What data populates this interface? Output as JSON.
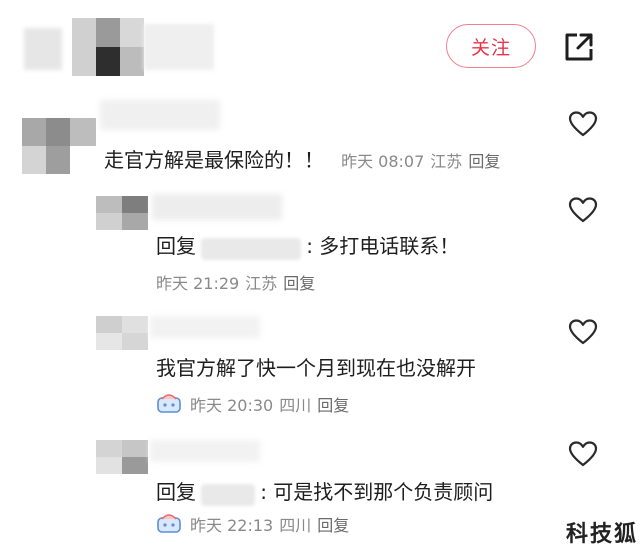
{
  "header": {
    "follow_label": "关注",
    "share_icon": "share-icon"
  },
  "comments": [
    {
      "text": "走官方解是最保险的！！",
      "time": "昨天 08:07",
      "location": "江苏",
      "reply_label": "回复"
    }
  ],
  "replies": [
    {
      "prefix": "回复",
      "text": ": 多打电话联系！",
      "time": "昨天 21:29",
      "location": "江苏",
      "reply_label": "回复"
    },
    {
      "text": "我官方解了快一个月到现在也没解开",
      "time": "昨天 20:30",
      "location": "四川",
      "reply_label": "回复"
    },
    {
      "prefix": "回复",
      "text": ": 可是找不到那个负责顾问",
      "time": "昨天 22:13",
      "location": "四川",
      "reply_label": "回复"
    }
  ],
  "watermark": "科技狐",
  "colors": {
    "accent": "#e8344a",
    "meta_gray": "#8a8a8a",
    "badge_blue": "#5b8fd6",
    "badge_pink": "#e86a6a"
  }
}
